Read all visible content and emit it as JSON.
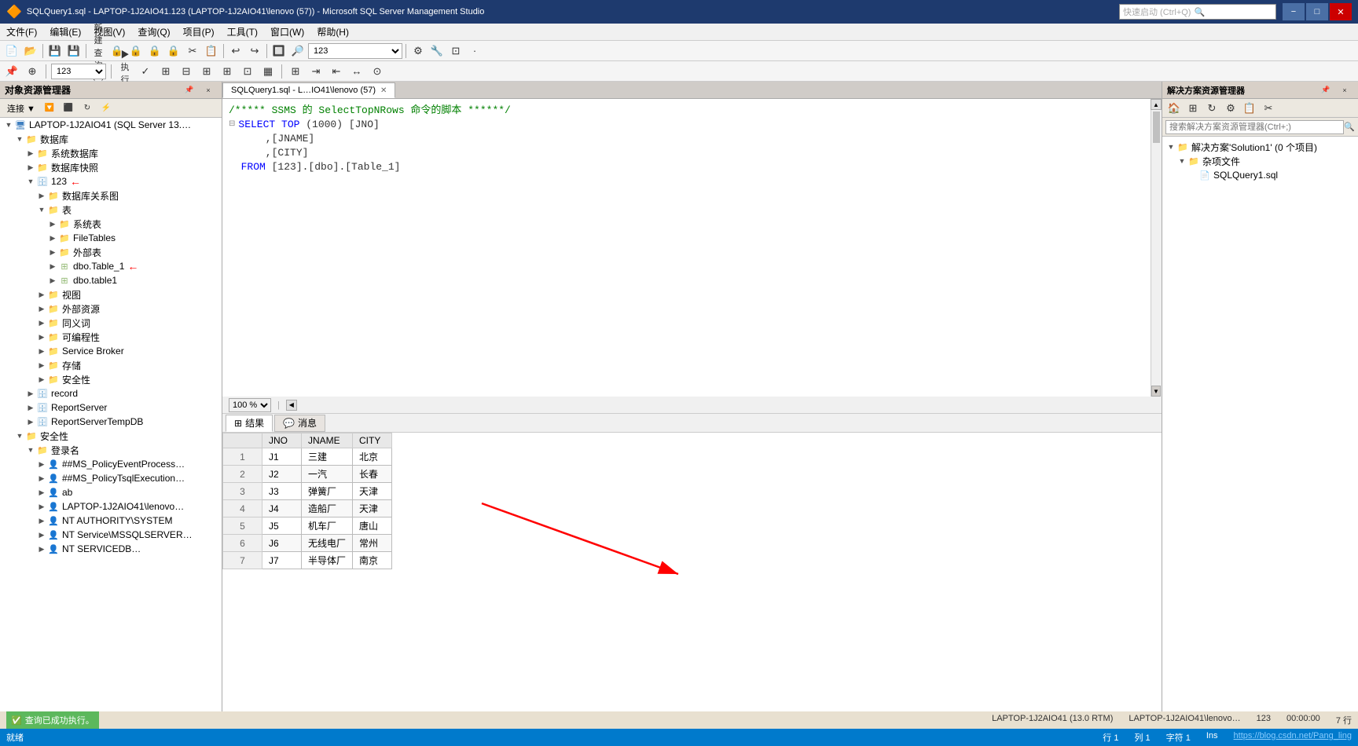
{
  "titleBar": {
    "searchPlaceholder": "快速启动 (Ctrl+Q)",
    "title": "SQLQuery1.sql - LAPTOP-1J2AIO41.123 (LAPTOP-1J2AIO41\\lenovo (57)) - Microsoft SQL Server Management Studio",
    "icon": "🔶",
    "winControls": [
      "−",
      "□",
      "✕"
    ]
  },
  "menuBar": {
    "items": [
      "文件(F)",
      "编辑(E)",
      "视图(V)",
      "查询(Q)",
      "项目(P)",
      "工具(T)",
      "窗口(W)",
      "帮助(H)"
    ]
  },
  "toolbar2": {
    "dbValue": "123",
    "executeLabel": "▶ 执行(X)",
    "checkLabel": "✓"
  },
  "objectExplorer": {
    "title": "对象资源管理器",
    "connectLabel": "连接 ▼",
    "tree": [
      {
        "id": "server",
        "level": 0,
        "label": "LAPTOP-1J2AIO41 (SQL Server 13.…",
        "icon": "server",
        "expanded": true
      },
      {
        "id": "databases",
        "level": 1,
        "label": "数据库",
        "icon": "folder",
        "expanded": true
      },
      {
        "id": "systemdbs",
        "level": 2,
        "label": "系统数据库",
        "icon": "folder",
        "expanded": false
      },
      {
        "id": "snapshot",
        "level": 2,
        "label": "数据库快照",
        "icon": "folder",
        "expanded": false
      },
      {
        "id": "db123",
        "level": 2,
        "label": "123",
        "icon": "db",
        "expanded": true,
        "hasArrow": true
      },
      {
        "id": "dbdiagram",
        "level": 3,
        "label": "数据库关系图",
        "icon": "folder",
        "expanded": false
      },
      {
        "id": "tables",
        "level": 3,
        "label": "表",
        "icon": "folder",
        "expanded": true
      },
      {
        "id": "systables",
        "level": 4,
        "label": "系统表",
        "icon": "folder",
        "expanded": false
      },
      {
        "id": "filetables",
        "level": 4,
        "label": "FileTables",
        "icon": "folder",
        "expanded": false
      },
      {
        "id": "externaltables",
        "level": 4,
        "label": "外部表",
        "icon": "folder",
        "expanded": false
      },
      {
        "id": "table1",
        "level": 4,
        "label": "dbo.Table_1",
        "icon": "table",
        "expanded": false,
        "hasArrow": true
      },
      {
        "id": "table1lower",
        "level": 4,
        "label": "dbo.table1",
        "icon": "table",
        "expanded": false
      },
      {
        "id": "views",
        "level": 3,
        "label": "视图",
        "icon": "folder",
        "expanded": false
      },
      {
        "id": "externalres",
        "level": 3,
        "label": "外部资源",
        "icon": "folder",
        "expanded": false
      },
      {
        "id": "synonyms",
        "level": 3,
        "label": "同义词",
        "icon": "folder",
        "expanded": false
      },
      {
        "id": "programmability",
        "level": 3,
        "label": "可编程性",
        "icon": "folder",
        "expanded": false
      },
      {
        "id": "servicebroker",
        "level": 3,
        "label": "Service Broker",
        "icon": "folder",
        "expanded": false
      },
      {
        "id": "storage",
        "level": 3,
        "label": "存储",
        "icon": "folder",
        "expanded": false
      },
      {
        "id": "security3",
        "level": 3,
        "label": "安全性",
        "icon": "folder",
        "expanded": false
      },
      {
        "id": "record",
        "level": 2,
        "label": "record",
        "icon": "db",
        "expanded": false
      },
      {
        "id": "reportserver",
        "level": 2,
        "label": "ReportServer",
        "icon": "db",
        "expanded": false
      },
      {
        "id": "reportservertempdb",
        "level": 2,
        "label": "ReportServerTempDB",
        "icon": "db",
        "expanded": false
      },
      {
        "id": "security",
        "level": 1,
        "label": "安全性",
        "icon": "folder",
        "expanded": true
      },
      {
        "id": "logins",
        "level": 2,
        "label": "登录名",
        "icon": "folder",
        "expanded": true
      },
      {
        "id": "login1",
        "level": 3,
        "label": "##MS_PolicyEventProcess…",
        "icon": "login",
        "expanded": false
      },
      {
        "id": "login2",
        "level": 3,
        "label": "##MS_PolicyTsqlExecution…",
        "icon": "login",
        "expanded": false
      },
      {
        "id": "login3",
        "level": 3,
        "label": "ab",
        "icon": "login",
        "expanded": false
      },
      {
        "id": "login4",
        "level": 3,
        "label": "LAPTOP-1J2AIO41\\lenovo…",
        "icon": "login",
        "expanded": false
      },
      {
        "id": "login5",
        "level": 3,
        "label": "NT AUTHORITY\\SYSTEM",
        "icon": "login",
        "expanded": false
      },
      {
        "id": "login6",
        "level": 3,
        "label": "NT Service\\MSSQLSERVER…",
        "icon": "login",
        "expanded": false
      },
      {
        "id": "login7",
        "level": 3,
        "label": "NT SERVICEDB…",
        "icon": "login",
        "expanded": false
      }
    ]
  },
  "queryTab": {
    "label": "SQLQuery1.sql - L…IO41\\lenovo (57)",
    "closeBtn": "✕"
  },
  "queryEditor": {
    "lines": [
      {
        "num": "",
        "content": "/***** SSMS 的 SelectTopNRows 命令的脚本 ******/",
        "type": "comment"
      },
      {
        "num": "",
        "content": "SELECT TOP (1000) [JNO]",
        "type": "code",
        "hasExpand": true
      },
      {
        "num": "",
        "content": "      ,[JNAME]",
        "type": "code"
      },
      {
        "num": "",
        "content": "      ,[CITY]",
        "type": "code"
      },
      {
        "num": "",
        "content": "  FROM [123].[dbo].[Table_1]",
        "type": "code"
      }
    ]
  },
  "zoomBar": {
    "zoom": "100 %"
  },
  "resultsTabs": [
    {
      "label": "结果",
      "icon": "grid",
      "active": true
    },
    {
      "label": "消息",
      "icon": "msg",
      "active": false
    }
  ],
  "resultsTable": {
    "columns": [
      "",
      "JNO",
      "JNAME",
      "CITY"
    ],
    "rows": [
      {
        "num": "1",
        "jno": "J1",
        "jname": "三建",
        "city": "北京"
      },
      {
        "num": "2",
        "jno": "J2",
        "jname": "一汽",
        "city": "长春"
      },
      {
        "num": "3",
        "jno": "J3",
        "jname": "弹簧厂",
        "city": "天津"
      },
      {
        "num": "4",
        "jno": "J4",
        "jname": "造船厂",
        "city": "天津"
      },
      {
        "num": "5",
        "jno": "J5",
        "jname": "机车厂",
        "city": "唐山"
      },
      {
        "num": "6",
        "jno": "J6",
        "jname": "无线电厂",
        "city": "常州"
      },
      {
        "num": "7",
        "jno": "J7",
        "jname": "半导体厂",
        "city": "南京"
      }
    ]
  },
  "solutionExplorer": {
    "title": "解决方案资源管理器",
    "searchPlaceholder": "搜索解决方案资源管理器(Ctrl+;)",
    "solutionLabel": "解决方案'Solution1' (0 个项目)",
    "miscFolder": "杂项文件",
    "sqlFile": "SQLQuery1.sql",
    "winControls": [
      "▲▼",
      "⊟",
      "×"
    ]
  },
  "statusBar": {
    "statusMsg": "查询已成功执行。",
    "server": "LAPTOP-1J2AIO41 (13.0 RTM)",
    "connection": "LAPTOP-1J2AIO41 (13.0 RTM)",
    "user": "LAPTOP-1J2AIO41\\lenovo…",
    "db": "123",
    "time": "00:00:00",
    "rows": "7 行",
    "bottom": {
      "ready": "就绪",
      "row": "行 1",
      "col": "列 1",
      "char": "字符 1",
      "ins": "Ins",
      "link": "https://blog.csdn.net/Pang_ling"
    }
  }
}
